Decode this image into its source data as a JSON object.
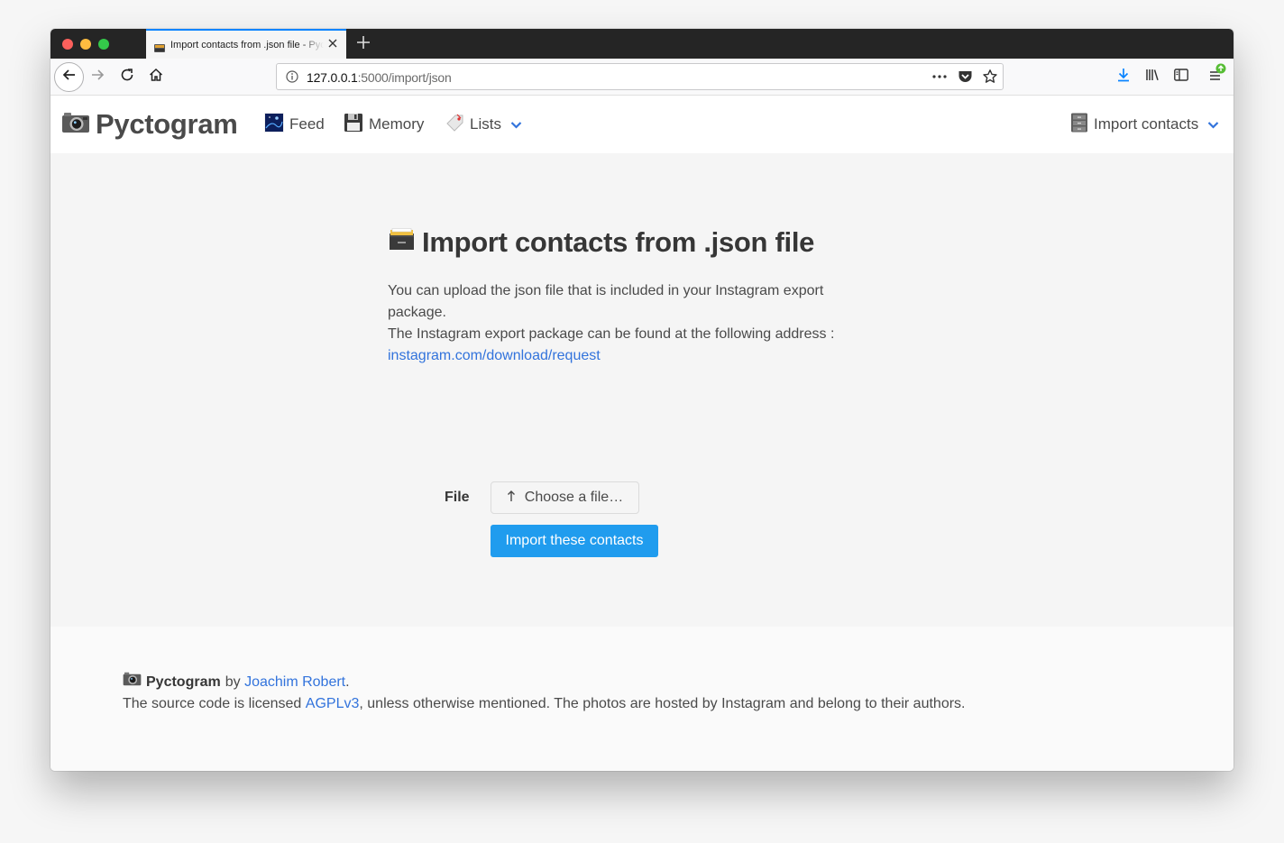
{
  "browser": {
    "tab_title": "Import contacts from .json file - Pyctogram",
    "url_host": "127.0.0.1",
    "url_rest": ":5000/import/json"
  },
  "navbar": {
    "brand": "Pyctogram",
    "items": [
      {
        "label": "Feed",
        "icon": "night-sky-icon"
      },
      {
        "label": "Memory",
        "icon": "floppy-disk-icon"
      },
      {
        "label": "Lists",
        "icon": "bookmark-tag-icon"
      }
    ],
    "right_item": {
      "label": "Import contacts",
      "icon": "file-cabinet-icon"
    }
  },
  "main": {
    "title": "Import contacts from .json file",
    "desc_line1": "You can upload the json file that is included in your Instagram export package.",
    "desc_line2": "The Instagram export package can be found at the following address :",
    "link_text": "instagram.com/download/request",
    "file_label": "File",
    "choose_file_label": "Choose a file…",
    "submit_label": "Import these contacts"
  },
  "footer": {
    "brand": "Pyctogram",
    "by_text": "by",
    "author": "Joachim Robert",
    "license_prefix": "The source code is licensed",
    "license": "AGPLv3",
    "license_suffix": ", unless otherwise mentioned. The photos are hosted by Instagram and belong to their authors."
  },
  "colors": {
    "accent": "#209cee",
    "link": "#3273dc",
    "tab_highlight": "#0a84ff"
  }
}
